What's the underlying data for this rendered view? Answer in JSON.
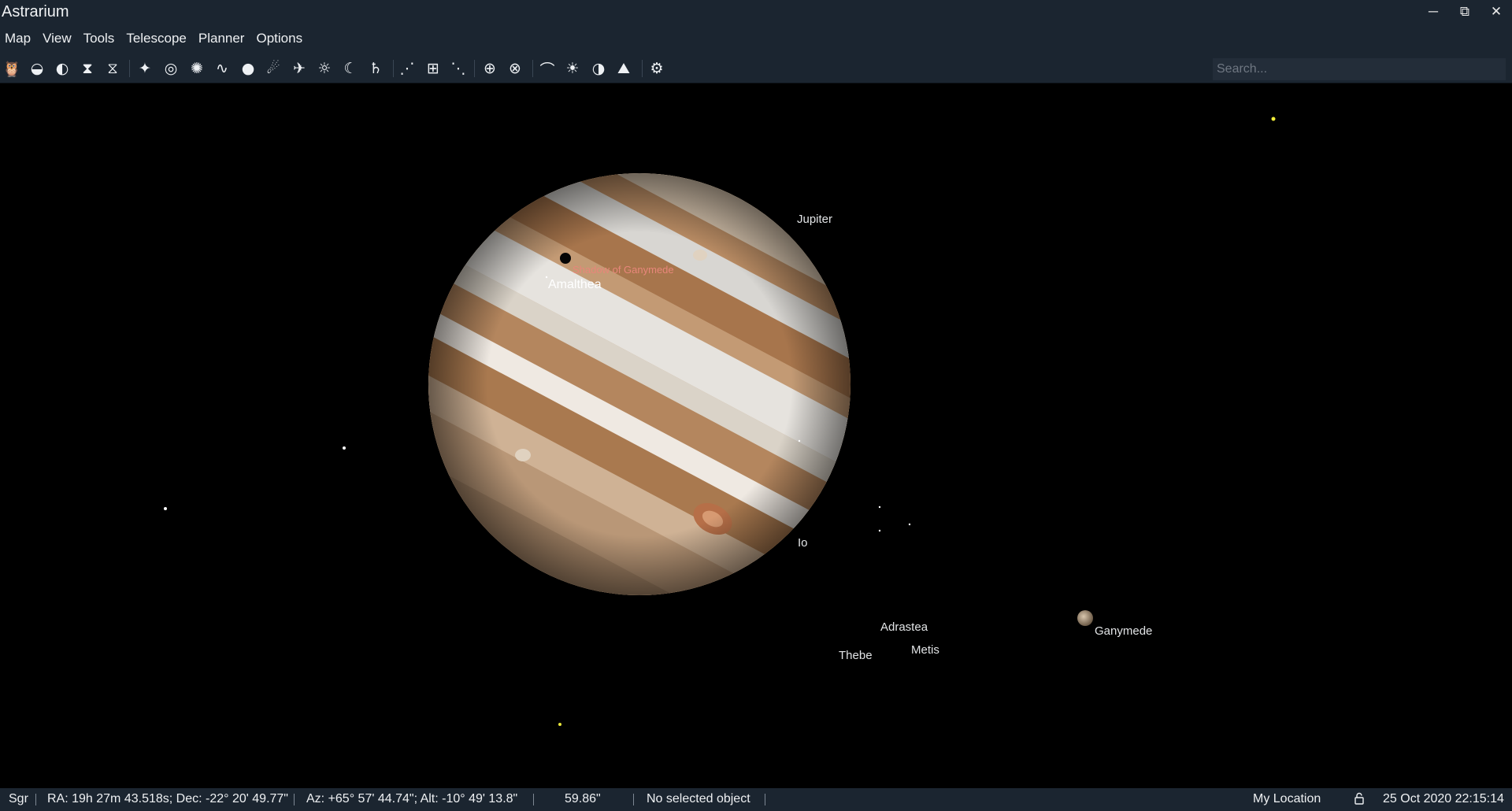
{
  "app": {
    "title": "Astrarium"
  },
  "window_controls": {
    "minimize": "─",
    "restore": "⧉",
    "close": "✕"
  },
  "menu": [
    "Map",
    "View",
    "Tools",
    "Telescope",
    "Planner",
    "Options"
  ],
  "toolbar": {
    "buttons": [
      {
        "icon": "owl-icon",
        "glyph": "🦉"
      },
      {
        "icon": "ground-icon",
        "glyph": "◒"
      },
      {
        "icon": "atmosphere-icon",
        "glyph": "◐"
      },
      {
        "icon": "mirror-icon",
        "glyph": "⧗"
      },
      {
        "icon": "flip-icon",
        "glyph": "⧖"
      },
      {
        "icon": "stars-icon",
        "glyph": "✦"
      },
      {
        "icon": "galaxy-icon",
        "glyph": "◎"
      },
      {
        "icon": "cluster-icon",
        "glyph": "✺"
      },
      {
        "icon": "milky-way-icon",
        "glyph": "∿"
      },
      {
        "icon": "nebula-icon",
        "glyph": "●"
      },
      {
        "icon": "comet-icon",
        "glyph": "☄"
      },
      {
        "icon": "satellite-icon",
        "glyph": "✈"
      },
      {
        "icon": "sun-icon",
        "glyph": "☼"
      },
      {
        "icon": "moon-icon",
        "glyph": "☾"
      },
      {
        "icon": "planet-icon",
        "glyph": "♄"
      },
      {
        "icon": "constellation-lines-icon",
        "glyph": "⋰"
      },
      {
        "icon": "constellation-borders-icon",
        "glyph": "⊞"
      },
      {
        "icon": "constellation-labels-icon",
        "glyph": "⋱"
      },
      {
        "icon": "equatorial-grid-icon",
        "glyph": "⊕"
      },
      {
        "icon": "horizontal-grid-icon",
        "glyph": "⊗"
      },
      {
        "icon": "meteor-icon",
        "glyph": "⌒"
      },
      {
        "icon": "sunrise-icon",
        "glyph": "☀"
      },
      {
        "icon": "day-night-icon",
        "glyph": "◑"
      },
      {
        "icon": "landscape-icon",
        "glyph": "⛰"
      },
      {
        "icon": "settings-gear-icon",
        "glyph": "⚙"
      }
    ]
  },
  "search": {
    "placeholder": "Search..."
  },
  "sky": {
    "labels": {
      "jupiter": "Jupiter",
      "shadow": "Shadow of Ganymede",
      "amalthea": "Amalthea",
      "io": "Io",
      "adrastea": "Adrastea",
      "thebe": "Thebe",
      "metis": "Metis",
      "ganymede": "Ganymede"
    }
  },
  "status": {
    "constellation": "Sgr",
    "equatorial": "RA: 19h 27m 43.518s; Dec: -22° 20' 49.77\"",
    "horizontal": "Az: +65° 57' 44.74\"; Alt: -10° 49' 13.8\"",
    "fov": "59.86\"",
    "selected": "No selected object",
    "location": "My Location",
    "lock_icon": "lock-icon",
    "datetime": "25 Oct 2020 22:15:14"
  }
}
